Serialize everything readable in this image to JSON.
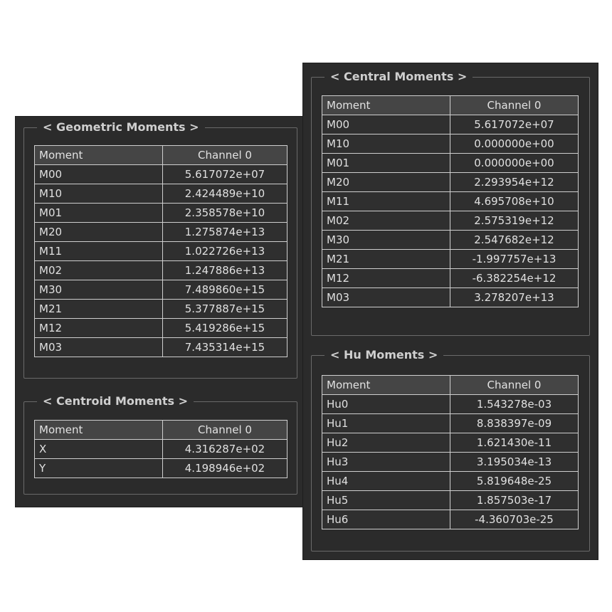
{
  "geometric": {
    "title": "< Geometric Moments >",
    "headers": [
      "Moment",
      "Channel 0"
    ],
    "rows": [
      [
        "M00",
        "5.617072e+07"
      ],
      [
        "M10",
        "2.424489e+10"
      ],
      [
        "M01",
        "2.358578e+10"
      ],
      [
        "M20",
        "1.275874e+13"
      ],
      [
        "M11",
        "1.022726e+13"
      ],
      [
        "M02",
        "1.247886e+13"
      ],
      [
        "M30",
        "7.489860e+15"
      ],
      [
        "M21",
        "5.377887e+15"
      ],
      [
        "M12",
        "5.419286e+15"
      ],
      [
        "M03",
        "7.435314e+15"
      ]
    ]
  },
  "centroid": {
    "title": "< Centroid Moments >",
    "headers": [
      "Moment",
      "Channel 0"
    ],
    "rows": [
      [
        "X",
        "4.316287e+02"
      ],
      [
        "Y",
        "4.198946e+02"
      ]
    ]
  },
  "central": {
    "title": "< Central Moments >",
    "headers": [
      "Moment",
      "Channel 0"
    ],
    "rows": [
      [
        "M00",
        "5.617072e+07"
      ],
      [
        "M10",
        "0.000000e+00"
      ],
      [
        "M01",
        "0.000000e+00"
      ],
      [
        "M20",
        "2.293954e+12"
      ],
      [
        "M11",
        "4.695708e+10"
      ],
      [
        "M02",
        "2.575319e+12"
      ],
      [
        "M30",
        "2.547682e+12"
      ],
      [
        "M21",
        "-1.997757e+13"
      ],
      [
        "M12",
        "-6.382254e+12"
      ],
      [
        "M03",
        "3.278207e+13"
      ]
    ]
  },
  "hu": {
    "title": "< Hu Moments >",
    "headers": [
      "Moment",
      "Channel 0"
    ],
    "rows": [
      [
        "Hu0",
        "1.543278e-03"
      ],
      [
        "Hu1",
        "8.838397e-09"
      ],
      [
        "Hu2",
        "1.621430e-11"
      ],
      [
        "Hu3",
        "3.195034e-13"
      ],
      [
        "Hu4",
        "5.819648e-25"
      ],
      [
        "Hu5",
        "1.857503e-17"
      ],
      [
        "Hu6",
        "-4.360703e-25"
      ]
    ]
  }
}
